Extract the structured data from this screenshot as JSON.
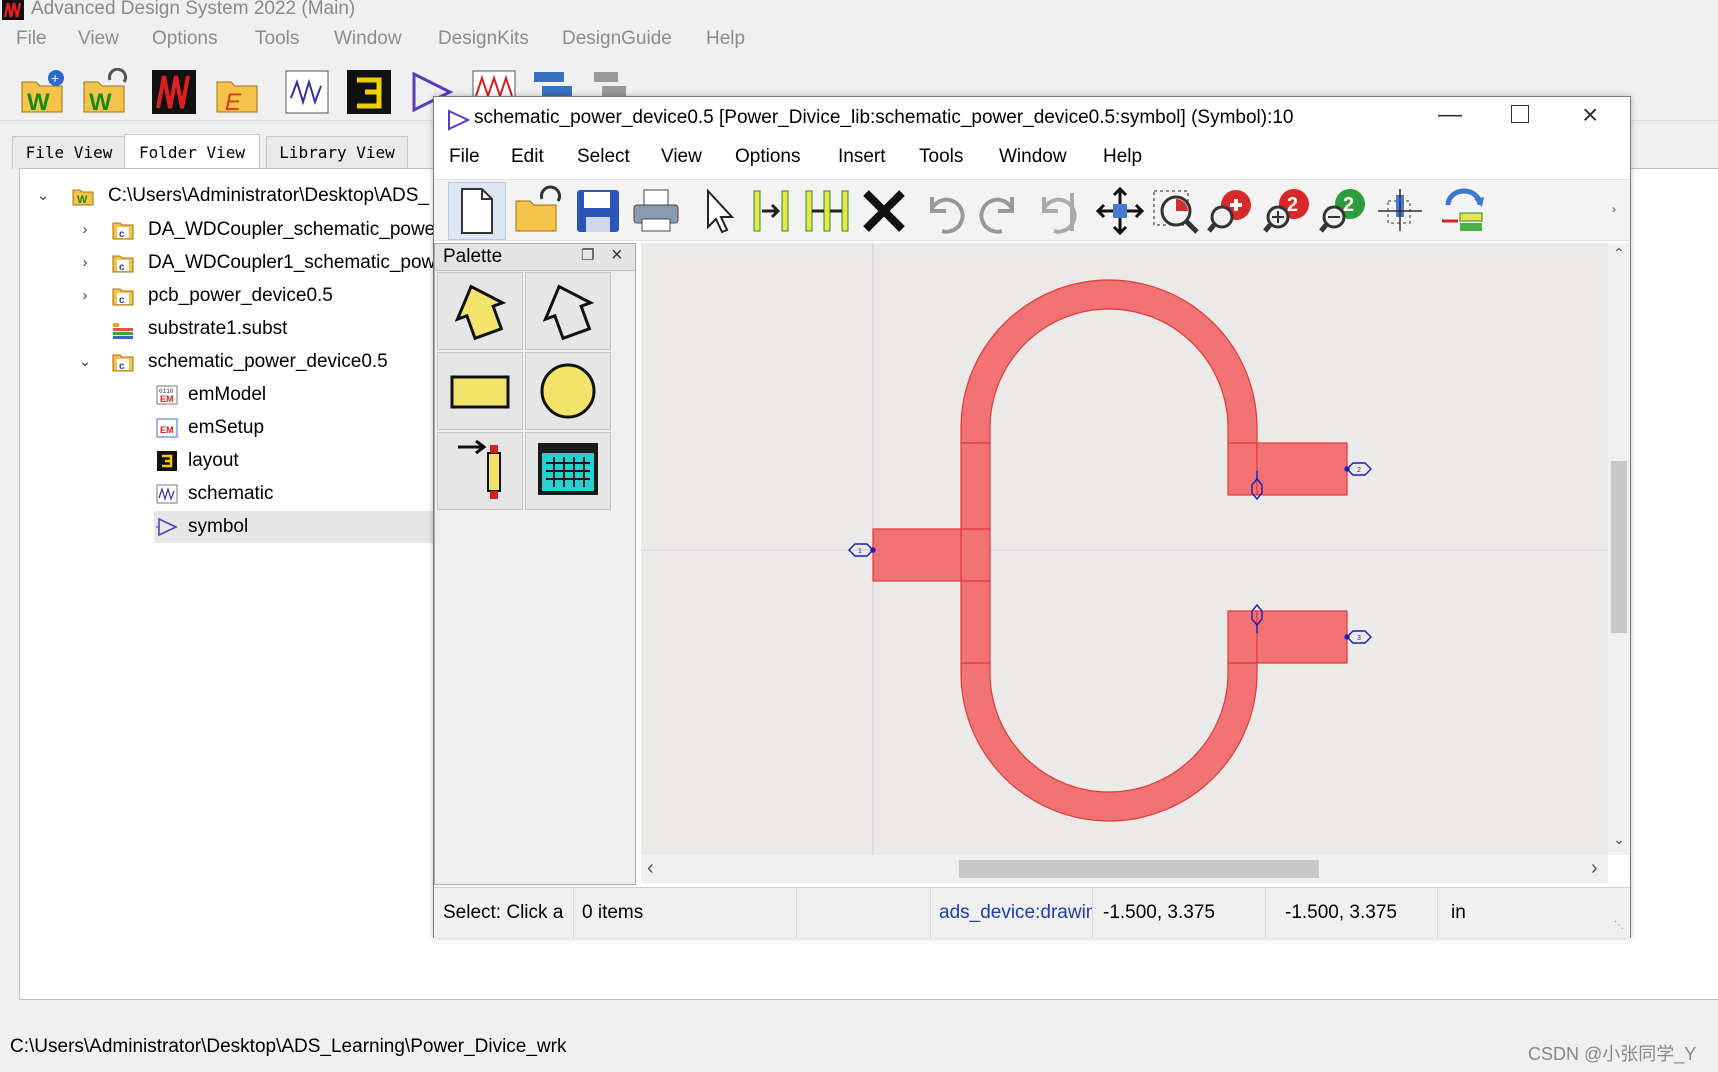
{
  "main_window": {
    "title": "Advanced Design System 2022 (Main)",
    "menu": [
      "File",
      "View",
      "Options",
      "Tools",
      "Window",
      "DesignKits",
      "DesignGuide",
      "Help"
    ],
    "tabs": [
      {
        "label": "File View"
      },
      {
        "label": "Folder View",
        "active": true
      },
      {
        "label": "Library View"
      }
    ],
    "tree": [
      {
        "label": "C:\\Users\\Administrator\\Desktop\\ADS_",
        "expanded": true,
        "icon": "workspace-icon"
      },
      {
        "label": "DA_WDCoupler_schematic_powe",
        "icon": "cell-icon"
      },
      {
        "label": "DA_WDCoupler1_schematic_pow",
        "icon": "cell-icon"
      },
      {
        "label": "pcb_power_device0.5",
        "icon": "cell-icon"
      },
      {
        "label": "substrate1.subst",
        "icon": "substrate-icon"
      },
      {
        "label": "schematic_power_device0.5",
        "expanded": true,
        "icon": "cell-icon"
      },
      {
        "label": "emModel",
        "icon": "em-model-icon"
      },
      {
        "label": "emSetup",
        "icon": "em-setup-icon"
      },
      {
        "label": "layout",
        "icon": "layout-icon"
      },
      {
        "label": "schematic",
        "icon": "schematic-icon"
      },
      {
        "label": "symbol",
        "icon": "symbol-icon",
        "selected": true
      }
    ],
    "status_path": "C:\\Users\\Administrator\\Desktop\\ADS_Learning\\Power_Divice_wrk",
    "watermark": "CSDN @小张同学_Y"
  },
  "symbol_window": {
    "title": "schematic_power_device0.5 [Power_Divice_lib:schematic_power_device0.5:symbol] (Symbol):10",
    "menu": [
      "File",
      "Edit",
      "Select",
      "View",
      "Options",
      "Insert",
      "Tools",
      "Window",
      "Help"
    ],
    "palette_title": "Palette",
    "status": {
      "prompt": "Select: Click a",
      "items": "0 items",
      "layer": "ads_device:drawing",
      "coord1": "-1.500, 3.375",
      "coord2": "-1.500, 3.375",
      "units": "in"
    },
    "pins": [
      "1",
      "2",
      "3"
    ]
  },
  "colors": {
    "shape_fill": "#f07272",
    "shape_edge": "#e03a3a",
    "pin": "#1c1cc0",
    "layer_text": "#1a3fb0"
  }
}
